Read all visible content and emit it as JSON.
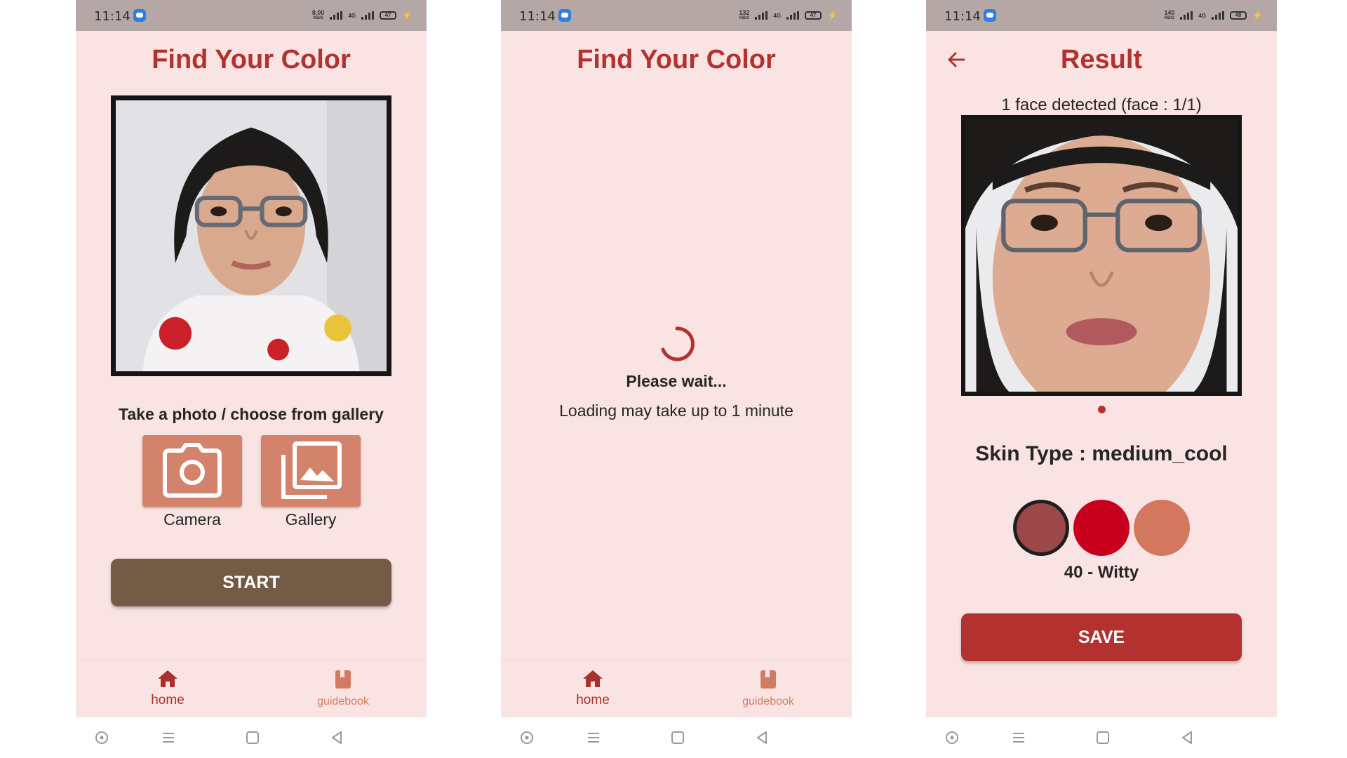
{
  "status_bar": {
    "time": "11:14",
    "screens": [
      {
        "net_speed": "8.00",
        "net_unit": "KB/S",
        "lte": "4G",
        "battery": "47"
      },
      {
        "net_speed": "132",
        "net_unit": "KB/S",
        "lte": "4G",
        "battery": "47"
      },
      {
        "net_speed": "140",
        "net_unit": "KB/S",
        "lte": "4G",
        "battery": "48"
      }
    ]
  },
  "screen1": {
    "title": "Find Your Color",
    "prompt": "Take a photo / choose from gallery",
    "camera_label": "Camera",
    "gallery_label": "Gallery",
    "start_label": "START"
  },
  "screen2": {
    "title": "Find Your Color",
    "wait_text": "Please wait...",
    "loading_text": "Loading may take up to 1 minute"
  },
  "screen3": {
    "title": "Result",
    "face_count": "1 face detected (face : 1/1)",
    "skin_type": "Skin Type : medium_cool",
    "swatch_colors": [
      "#9a4848",
      "#c8001e",
      "#d3775e"
    ],
    "selected_swatch": 0,
    "shade_name": "40 - Witty",
    "save_label": "SAVE"
  },
  "nav": {
    "home_label": "home",
    "guide_label": "guidebook"
  },
  "colors": {
    "accent": "#b3312f",
    "background": "#fae4e3",
    "button_brown": "#735b45",
    "action_tile": "#d3836b"
  },
  "icons": [
    "home-icon",
    "book-icon",
    "camera-icon",
    "gallery-icon",
    "back-arrow-icon",
    "spinner-icon"
  ]
}
